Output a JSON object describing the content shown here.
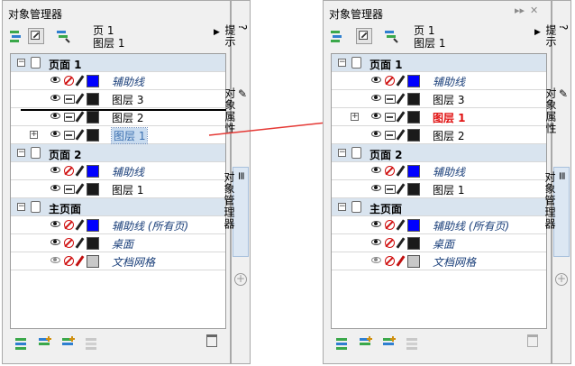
{
  "panel_title": "对象管理器",
  "window_buttons": {
    "pin": "▸▸",
    "close": "✕"
  },
  "page_info": {
    "page": "页 1",
    "layer": "图层 1"
  },
  "sidebar_tabs": {
    "hint": "提示",
    "properties": "对象属性",
    "manager": "对象管理器"
  },
  "left": {
    "rows": [
      {
        "type": "group",
        "label": "页面 1",
        "expander": "⊟"
      },
      {
        "type": "layer",
        "label": "辅助线",
        "style": "italic",
        "swatch": "#0000ff",
        "print": "no"
      },
      {
        "type": "layer",
        "label": "图层 3",
        "style": "normal",
        "swatch": "#1a1a1a",
        "print": "yes"
      },
      {
        "type": "layer",
        "label": "图层 2",
        "style": "normal",
        "swatch": "#1a1a1a",
        "print": "yes"
      },
      {
        "type": "layer",
        "label": "图层 1",
        "style": "selected",
        "swatch": "#1a1a1a",
        "print": "yes",
        "expander": "⊞"
      },
      {
        "type": "group",
        "label": "页面 2",
        "expander": "⊟"
      },
      {
        "type": "layer",
        "label": "辅助线",
        "style": "italic",
        "swatch": "#0000ff",
        "print": "no"
      },
      {
        "type": "layer",
        "label": "图层 1",
        "style": "normal",
        "swatch": "#1a1a1a",
        "print": "yes"
      },
      {
        "type": "group",
        "label": "主页面",
        "expander": "⊟"
      },
      {
        "type": "layer",
        "label": "辅助线 (所有页)",
        "style": "italic",
        "swatch": "#0000ff",
        "print": "no"
      },
      {
        "type": "layer",
        "label": "桌面",
        "style": "italic",
        "swatch": "#1a1a1a",
        "print": "no"
      },
      {
        "type": "layer",
        "label": "文档网格",
        "style": "italic",
        "swatch": "#c8c8c8",
        "print": "no",
        "dim": true
      }
    ]
  },
  "right": {
    "rows": [
      {
        "type": "group",
        "label": "页面 1",
        "expander": "⊟"
      },
      {
        "type": "layer",
        "label": "辅助线",
        "style": "italic",
        "swatch": "#0000ff",
        "print": "no"
      },
      {
        "type": "layer",
        "label": "图层 3",
        "style": "normal",
        "swatch": "#1a1a1a",
        "print": "yes"
      },
      {
        "type": "layer",
        "label": "图层 1",
        "style": "red",
        "swatch": "#1a1a1a",
        "print": "yes",
        "expander": "⊞",
        "pencil_red": true
      },
      {
        "type": "layer",
        "label": "图层 2",
        "style": "normal",
        "swatch": "#1a1a1a",
        "print": "yes"
      },
      {
        "type": "group",
        "label": "页面 2",
        "expander": "⊟"
      },
      {
        "type": "layer",
        "label": "辅助线",
        "style": "italic",
        "swatch": "#0000ff",
        "print": "no"
      },
      {
        "type": "layer",
        "label": "图层 1",
        "style": "normal",
        "swatch": "#1a1a1a",
        "print": "yes"
      },
      {
        "type": "group",
        "label": "主页面",
        "expander": "⊟"
      },
      {
        "type": "layer",
        "label": "辅助线 (所有页)",
        "style": "italic",
        "swatch": "#0000ff",
        "print": "no"
      },
      {
        "type": "layer",
        "label": "桌面",
        "style": "italic",
        "swatch": "#1a1a1a",
        "print": "no"
      },
      {
        "type": "layer",
        "label": "文档网格",
        "style": "italic",
        "swatch": "#c8c8c8",
        "print": "no",
        "dim": true
      }
    ]
  },
  "colors": {
    "arrow": "#e53935",
    "group_bg": "#d9e4ef",
    "accent": "#3a6fb0"
  }
}
